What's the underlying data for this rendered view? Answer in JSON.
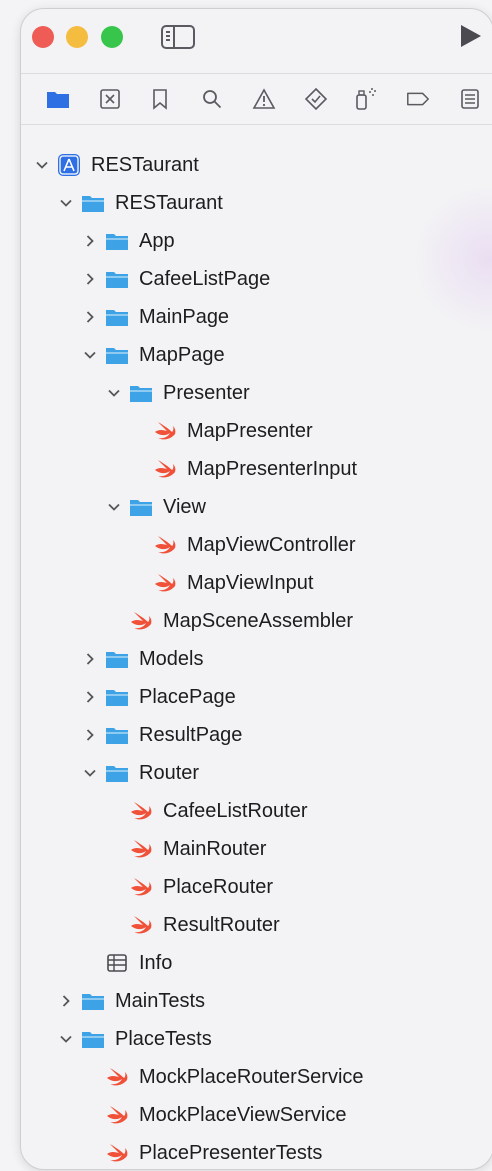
{
  "tree": {
    "items": [
      {
        "label": "RESTaurant",
        "icon": "app-project-icon",
        "expanded": true
      },
      {
        "label": "RESTaurant",
        "icon": "folder-icon",
        "expanded": true
      },
      {
        "label": "App",
        "icon": "folder-icon",
        "expanded": false
      },
      {
        "label": "CafeeListPage",
        "icon": "folder-icon",
        "expanded": false
      },
      {
        "label": "MainPage",
        "icon": "folder-icon",
        "expanded": false
      },
      {
        "label": "MapPage",
        "icon": "folder-icon",
        "expanded": true
      },
      {
        "label": "Presenter",
        "icon": "folder-icon",
        "expanded": true
      },
      {
        "label": "MapPresenter",
        "icon": "swift-file-icon"
      },
      {
        "label": "MapPresenterInput",
        "icon": "swift-file-icon"
      },
      {
        "label": "View",
        "icon": "folder-icon",
        "expanded": true
      },
      {
        "label": "MapViewController",
        "icon": "swift-file-icon"
      },
      {
        "label": "MapViewInput",
        "icon": "swift-file-icon"
      },
      {
        "label": "MapSceneAssembler",
        "icon": "swift-file-icon"
      },
      {
        "label": "Models",
        "icon": "folder-icon",
        "expanded": false
      },
      {
        "label": "PlacePage",
        "icon": "folder-icon",
        "expanded": false
      },
      {
        "label": "ResultPage",
        "icon": "folder-icon",
        "expanded": false
      },
      {
        "label": "Router",
        "icon": "folder-icon",
        "expanded": true
      },
      {
        "label": "CafeeListRouter",
        "icon": "swift-file-icon"
      },
      {
        "label": "MainRouter",
        "icon": "swift-file-icon"
      },
      {
        "label": "PlaceRouter",
        "icon": "swift-file-icon"
      },
      {
        "label": "ResultRouter",
        "icon": "swift-file-icon"
      },
      {
        "label": "Info",
        "icon": "plist-icon"
      },
      {
        "label": "MainTests",
        "icon": "folder-icon",
        "expanded": false
      },
      {
        "label": "PlaceTests",
        "icon": "folder-icon",
        "expanded": true
      },
      {
        "label": "MockPlaceRouterService",
        "icon": "swift-file-icon"
      },
      {
        "label": "MockPlaceViewService",
        "icon": "swift-file-icon"
      },
      {
        "label": "PlacePresenterTests",
        "icon": "swift-file-icon"
      }
    ]
  },
  "colors": {
    "folder": "#3ea3e6",
    "swift": "#f05138",
    "accent": "#2f6fe4"
  }
}
